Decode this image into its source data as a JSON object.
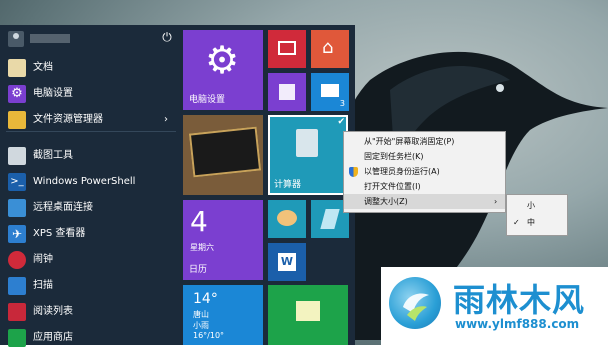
{
  "start_menu": {
    "items": [
      {
        "label": "文档",
        "icon": "documents-icon"
      },
      {
        "label": "电脑设置",
        "icon": "settings-gear-icon"
      },
      {
        "label": "文件资源管理器",
        "icon": "folder-icon",
        "has_submenu": true
      },
      {
        "label": "截图工具",
        "icon": "snipping-tool-icon"
      },
      {
        "label": "Windows PowerShell",
        "icon": "powershell-icon"
      },
      {
        "label": "远程桌面连接",
        "icon": "remote-desktop-icon"
      },
      {
        "label": "XPS 查看器",
        "icon": "xps-viewer-icon"
      },
      {
        "label": "闹钟",
        "icon": "alarm-clock-icon"
      },
      {
        "label": "扫描",
        "icon": "scan-icon"
      },
      {
        "label": "阅读列表",
        "icon": "reading-list-icon"
      },
      {
        "label": "应用商店",
        "icon": "store-icon"
      }
    ]
  },
  "tiles": {
    "settings": {
      "label": "电脑设置"
    },
    "calculator": {
      "label": "计算器"
    },
    "calendar": {
      "day": "4",
      "weekday": "星期六",
      "label": "日历"
    },
    "weather": {
      "temp": "14°",
      "city": "唐山",
      "condition": "小雨",
      "range": "16°/10°"
    },
    "mail": {
      "badge": "3"
    }
  },
  "context_menu": {
    "items": [
      {
        "label": "从\"开始\"屏幕取消固定(P)"
      },
      {
        "label": "固定到任务栏(K)"
      },
      {
        "label": "以管理员身份运行(A)"
      },
      {
        "label": "打开文件位置(I)"
      },
      {
        "label": "调整大小(Z)",
        "has_submenu": true
      }
    ],
    "submenu": [
      {
        "label": "小"
      },
      {
        "label": "中",
        "checked": true
      }
    ]
  },
  "watermark": {
    "brand": "雨林木风",
    "url": "www.ylmf888.com"
  },
  "colors": {
    "start_bg": "#1b2a3a",
    "purple_tile": "#7b3fd0",
    "teal_tile": "#1f9ab8",
    "blue_tile": "#1b87d6",
    "red_tile": "#d02a3a",
    "orange_tile": "#e0583a",
    "green_tile": "#1da34a"
  }
}
